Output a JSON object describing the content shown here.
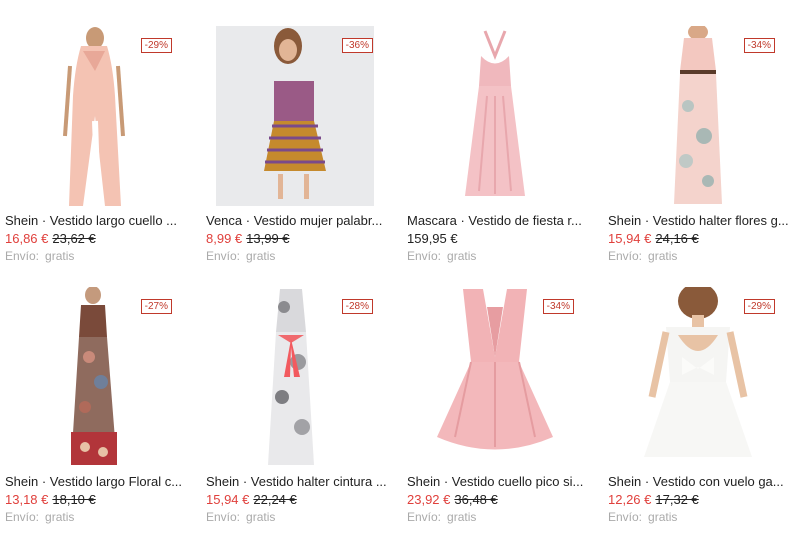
{
  "products": [
    {
      "title": "Shein · Vestido largo cuello ...",
      "price": "16,86 €",
      "old_price": "23,62 €",
      "discount": "-29%",
      "shipping_label": "Envío:",
      "shipping_value": "gratis"
    },
    {
      "title": "Venca · Vestido mujer palabr...",
      "price": "8,99 €",
      "old_price": "13,99 €",
      "discount": "-36%",
      "shipping_label": "Envío:",
      "shipping_value": "gratis"
    },
    {
      "title": "Mascara · Vestido de fiesta r...",
      "price": "159,95 €",
      "old_price": "",
      "discount": "",
      "shipping_label": "Envío:",
      "shipping_value": "gratis"
    },
    {
      "title": "Shein · Vestido halter flores g...",
      "price": "15,94 €",
      "old_price": "24,16 €",
      "discount": "-34%",
      "shipping_label": "Envío:",
      "shipping_value": "gratis"
    },
    {
      "title": "Shein · Vestido largo Floral c...",
      "price": "13,18 €",
      "old_price": "18,10 €",
      "discount": "-27%",
      "shipping_label": "Envío:",
      "shipping_value": "gratis"
    },
    {
      "title": "Shein · Vestido halter cintura ...",
      "price": "15,94 €",
      "old_price": "22,24 €",
      "discount": "-28%",
      "shipping_label": "Envío:",
      "shipping_value": "gratis"
    },
    {
      "title": "Shein · Vestido cuello pico si...",
      "price": "23,92 €",
      "old_price": "36,48 €",
      "discount": "-34%",
      "shipping_label": "Envío:",
      "shipping_value": "gratis"
    },
    {
      "title": "Shein · Vestido con vuelo ga...",
      "price": "12,26 €",
      "old_price": "17,32 €",
      "discount": "-29%",
      "shipping_label": "Envío:",
      "shipping_value": "gratis"
    }
  ]
}
